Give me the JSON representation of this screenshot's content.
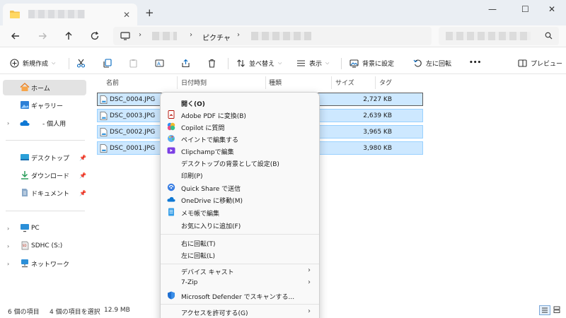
{
  "window": {
    "new_tab": "+",
    "tab_close": "✕",
    "minimize": "—",
    "maximize": "☐",
    "close": "✕"
  },
  "addressbar": {
    "separator": "›",
    "folder": "ピクチャ"
  },
  "toolbar": {
    "new_label": "新規作成",
    "sort_label": "並べ替え",
    "view_label": "表示",
    "set_background_label": "背景に設定",
    "rotate_left_label": "左に回転",
    "more_label": "•••",
    "preview_label": "プレビュー"
  },
  "sidebar": {
    "items": [
      {
        "label": "ホーム"
      },
      {
        "label": "ギャラリー"
      },
      {
        "label": "- 個人用"
      },
      {
        "label": "デスクトップ"
      },
      {
        "label": "ダウンロード"
      },
      {
        "label": "ドキュメント"
      },
      {
        "label": "PC"
      },
      {
        "label": "SDHC (S:)"
      },
      {
        "label": "ネットワーク"
      }
    ]
  },
  "filelist": {
    "columns": [
      "名前",
      "日付時刻",
      "種類",
      "サイズ",
      "タグ"
    ],
    "rows": [
      {
        "name": "DSC_0004.JPG",
        "size": "2,727 KB"
      },
      {
        "name": "DSC_0003.JPG",
        "size": "2,639 KB"
      },
      {
        "name": "DSC_0002.JPG",
        "size": "3,965 KB"
      },
      {
        "name": "DSC_0001.JPG",
        "size": "3,980 KB"
      }
    ]
  },
  "status": {
    "count": "6 個の項目",
    "selected": "4 個の項目を選択",
    "size": "12.9 MB"
  },
  "context_menu": {
    "items": [
      {
        "label": "開く(O)"
      },
      {
        "label": "Adobe PDF に変換(B)"
      },
      {
        "label": "Copilot に質問"
      },
      {
        "label": "ペイントで編集する"
      },
      {
        "label": "Clipchampで編集"
      },
      {
        "label": "デスクトップの背景として設定(B)"
      },
      {
        "label": "印刷(P)"
      },
      {
        "label": "Quick Share で送信"
      },
      {
        "label": "OneDrive に移動(M)"
      },
      {
        "label": "メモ帳で編集"
      },
      {
        "label": "お気に入りに追加(F)"
      },
      {
        "label": "右に回転(T)"
      },
      {
        "label": "左に回転(L)"
      },
      {
        "label": "デバイス キャスト"
      },
      {
        "label": "7-Zip"
      },
      {
        "label": "Microsoft Defender でスキャンする..."
      },
      {
        "label": "アクセスを許可する(G)"
      }
    ],
    "submenu_arrow": "›"
  },
  "colors": {
    "selection_fill": "#cde8ff",
    "selection_border": "#99d1ff",
    "accent": "#0067c0"
  }
}
